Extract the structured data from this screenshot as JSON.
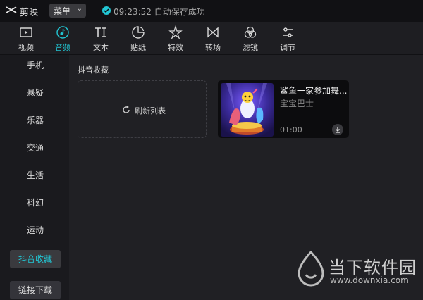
{
  "app": {
    "name": "剪映",
    "menu_label": "菜单",
    "save_status": "09:23:52 自动保存成功"
  },
  "colors": {
    "accent": "#22c6d4",
    "background": "#111114",
    "panel": "#202024"
  },
  "tabs": [
    {
      "label": "视频",
      "icon": "video-icon",
      "active": false
    },
    {
      "label": "音频",
      "icon": "audio-icon",
      "active": true
    },
    {
      "label": "文本",
      "icon": "text-icon",
      "active": false
    },
    {
      "label": "贴纸",
      "icon": "sticker-icon",
      "active": false
    },
    {
      "label": "特效",
      "icon": "effects-icon",
      "active": false
    },
    {
      "label": "转场",
      "icon": "transition-icon",
      "active": false
    },
    {
      "label": "滤镜",
      "icon": "filter-icon",
      "active": false
    },
    {
      "label": "调节",
      "icon": "adjust-icon",
      "active": false
    }
  ],
  "sidebar": {
    "items": [
      {
        "label": "手机"
      },
      {
        "label": "悬疑"
      },
      {
        "label": "乐器"
      },
      {
        "label": "交通"
      },
      {
        "label": "生活"
      },
      {
        "label": "科幻"
      },
      {
        "label": "运动"
      },
      {
        "label": "抖音收藏",
        "active": true
      },
      {
        "label": "链接下载"
      }
    ]
  },
  "main": {
    "section_title": "抖音收藏",
    "refresh_label": "刷新列表",
    "track": {
      "title": "鲨鱼一家参加舞...",
      "artist": "宝宝巴士",
      "duration": "01:00"
    }
  },
  "watermark": {
    "text": "当下软件园",
    "url": "www.downxia.com"
  }
}
